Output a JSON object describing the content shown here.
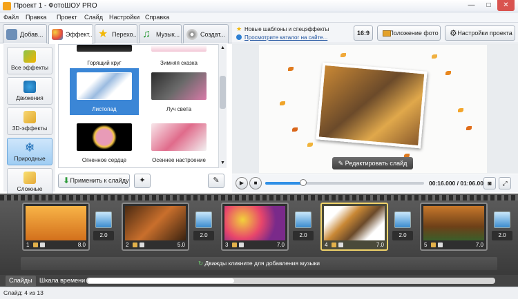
{
  "window": {
    "title": "Проект 1 - ФотоШОУ PRO",
    "minimize": "—",
    "maximize": "□",
    "close": "✕"
  },
  "menu": [
    "Файл",
    "Правка",
    "Проект",
    "Слайд",
    "Настройки",
    "Справка"
  ],
  "tabs": [
    {
      "label": "Добав...",
      "icon": "folder-photo-icon"
    },
    {
      "label": "Эффект...",
      "icon": "palette-icon"
    },
    {
      "label": "Перехо...",
      "icon": "star-icon"
    },
    {
      "label": "Музык...",
      "icon": "music-note-icon"
    },
    {
      "label": "Создат...",
      "icon": "film-reel-icon"
    }
  ],
  "categories": [
    {
      "label": "Все эффекты"
    },
    {
      "label": "Движения"
    },
    {
      "label": "3D-эффекты"
    },
    {
      "label": "Природные"
    },
    {
      "label": "Сложные"
    }
  ],
  "effects": [
    {
      "label": "Горящий круг"
    },
    {
      "label": "Зимняя сказка"
    },
    {
      "label": "Листопад"
    },
    {
      "label": "Луч света"
    },
    {
      "label": "Огненное сердце"
    },
    {
      "label": "Осеннее настроение"
    }
  ],
  "apply_button": "Применить к слайду",
  "promo": {
    "line1": "Новые шаблоны и спецэффекты",
    "line2": "Просмотрите каталог на сайте..."
  },
  "aspect_button": "16:9",
  "photo_position_button": "Положение фото",
  "project_settings_button": "Настройки проекта",
  "edit_slide_button": "Редактировать слайд",
  "player": {
    "time": "00:16.000 / 01:06.000",
    "progress": 0.24
  },
  "slides": [
    {
      "num": "1",
      "dur": "8.0"
    },
    {
      "num": "2",
      "dur": "5.0"
    },
    {
      "num": "3",
      "dur": "7.0"
    },
    {
      "num": "4",
      "dur": "7.0"
    },
    {
      "num": "5",
      "dur": "7.0"
    }
  ],
  "transitions": [
    "2.0",
    "2.0",
    "2.0",
    "2.0",
    "2.0"
  ],
  "music_hint": "Дважды кликните для добавления музыки",
  "bottom_tabs": [
    "Слайды",
    "Шкала времени"
  ],
  "status": "Слайд: 4 из 13"
}
